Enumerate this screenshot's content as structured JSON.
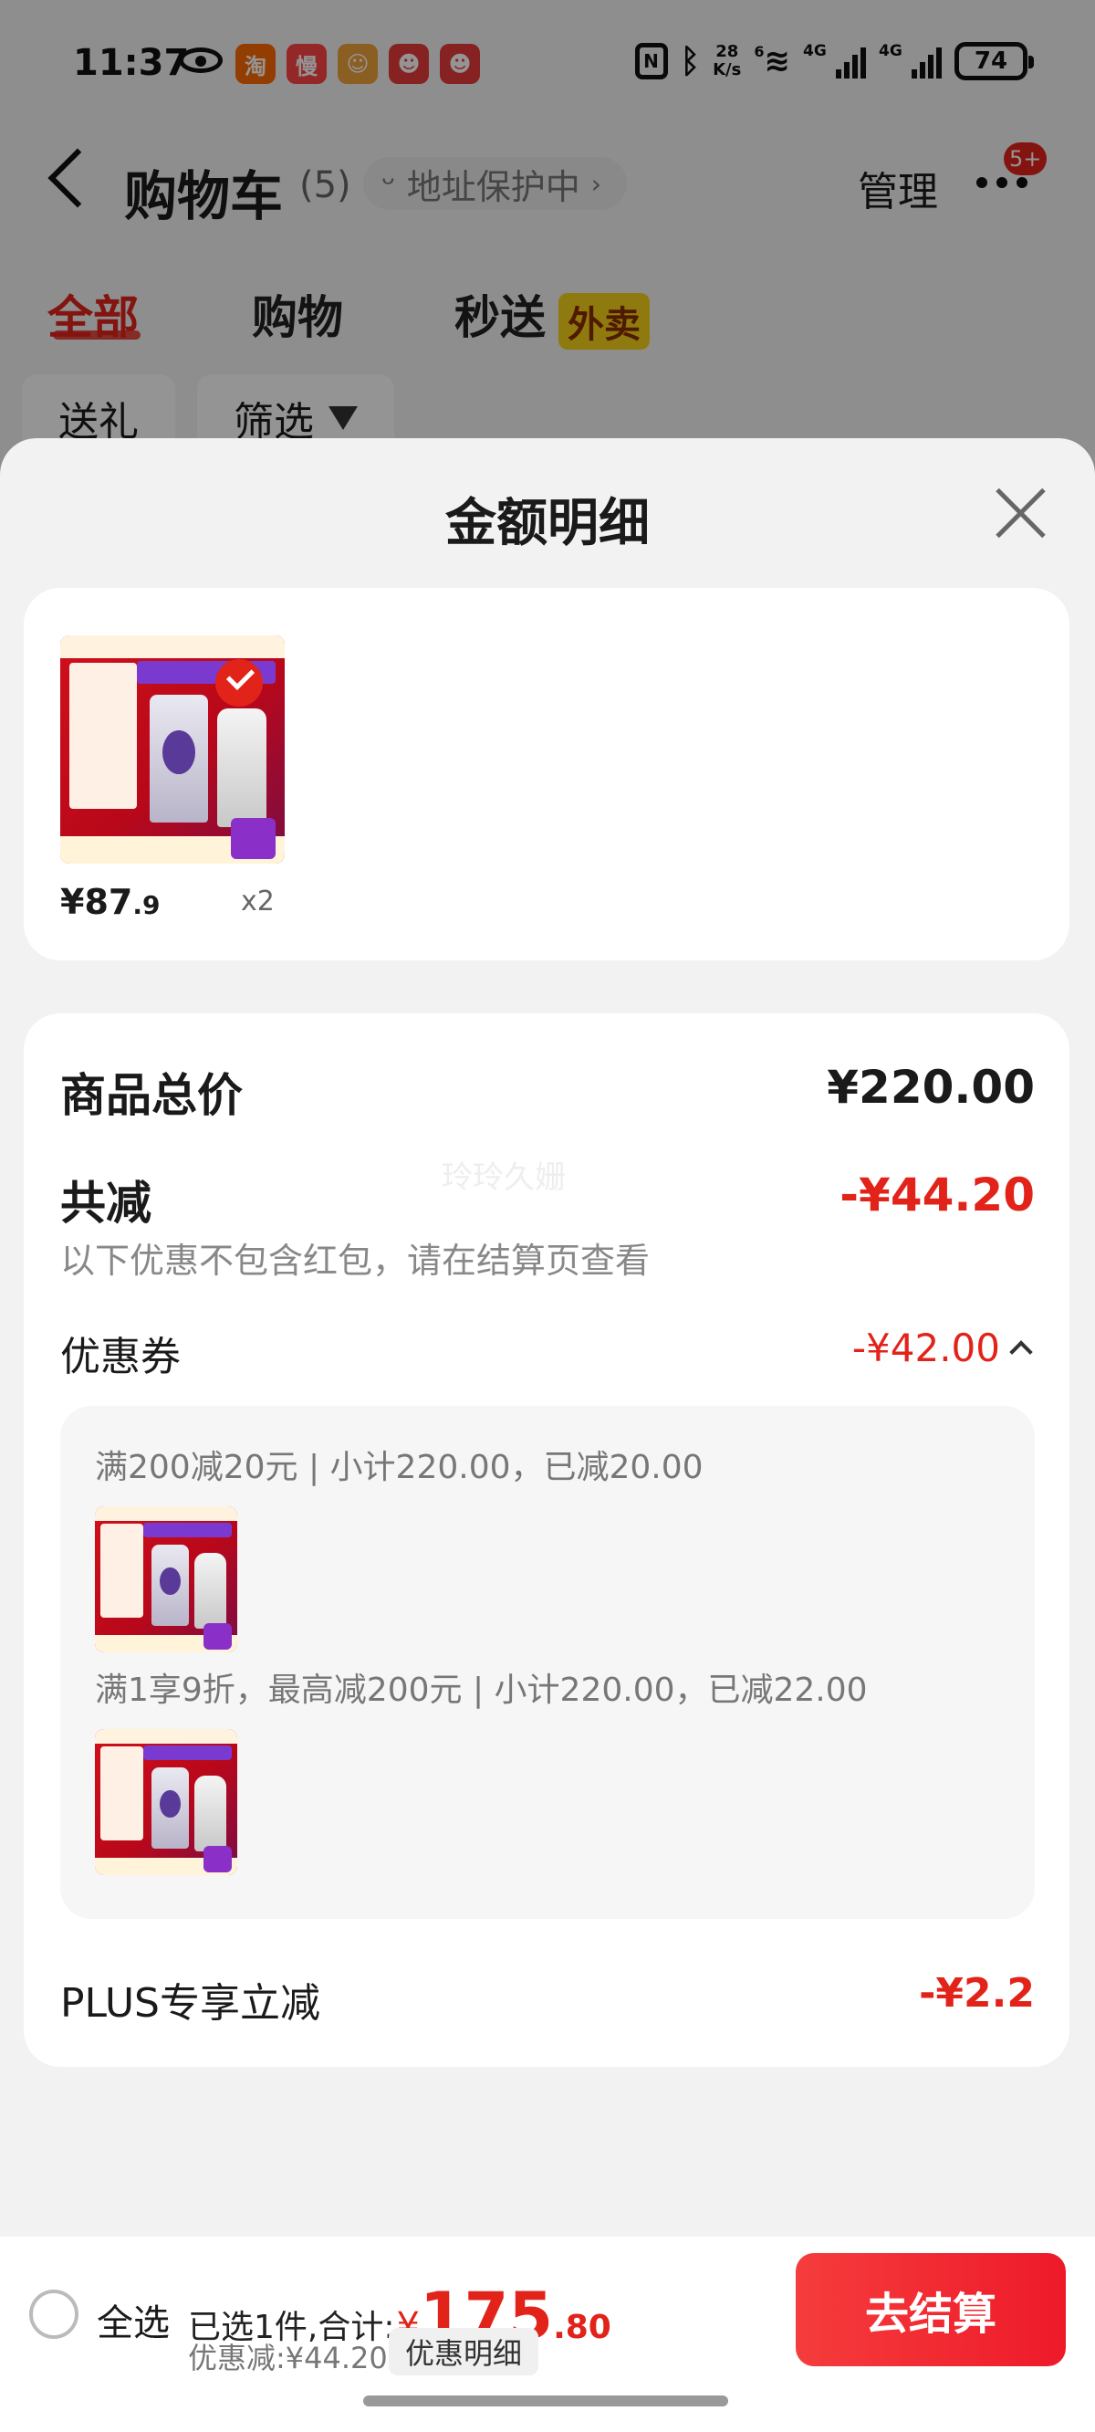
{
  "status_bar": {
    "time": "11:37",
    "app_icons": [
      {
        "name": "taobao-icon",
        "glyph": "淘",
        "color": "#ff6a00"
      },
      {
        "name": "man-icon",
        "glyph": "慢",
        "color": "#ff4444"
      },
      {
        "name": "app3-icon",
        "glyph": "☺",
        "color": "#f0a23a"
      },
      {
        "name": "jd-icon-1",
        "glyph": "☻",
        "color": "#e93b3d"
      },
      {
        "name": "jd-icon-2",
        "glyph": "☻",
        "color": "#e93b3d"
      }
    ],
    "net_speed_value": "28",
    "net_speed_unit": "K/s",
    "signal1_label": "4G",
    "signal2_label": "4G",
    "wifi_label": "6",
    "battery": "74"
  },
  "header": {
    "title": "购物车",
    "count": "(5)",
    "address_pill": "地址保护中",
    "manage": "管理",
    "badge": "5+"
  },
  "tabs": [
    {
      "label": "全部",
      "active": true
    },
    {
      "label": "购物",
      "active": false
    },
    {
      "label": "秒送",
      "active": false,
      "badge": "外卖"
    }
  ],
  "chips": [
    {
      "label": "送礼"
    },
    {
      "label": "筛选"
    }
  ],
  "sheet": {
    "title": "金额明细",
    "item": {
      "price_int": "¥87",
      "price_dec": ".9",
      "qty": "x2"
    },
    "summary": {
      "total_label": "商品总价",
      "total_value": "¥220.00",
      "reduce_label": "共减",
      "reduce_value": "-¥44.20",
      "note": "以下优惠不包含红包，请在结算页查看",
      "coupon_label": "优惠券",
      "coupon_value": "-¥42.00",
      "coupon_lines": [
        "满200减20元 | 小计220.00，已减20.00",
        "满1享9折，最高减200元 | 小计220.00，已减22.00"
      ],
      "plus_label": "PLUS专享立减",
      "plus_value": "-¥2.2",
      "watermark": "玲玲久姗"
    }
  },
  "bottom_bar": {
    "select_all": "全选",
    "selected_text": "已选1件,合计:",
    "total_yen": "¥",
    "total_int": "175",
    "total_dec": ".80",
    "discount": "优惠减:¥44.20",
    "detail_button": "优惠明细",
    "checkout": "去结算"
  },
  "colors": {
    "accent_red": "#e2231a",
    "waimai_yellow": "#f6d21a"
  }
}
